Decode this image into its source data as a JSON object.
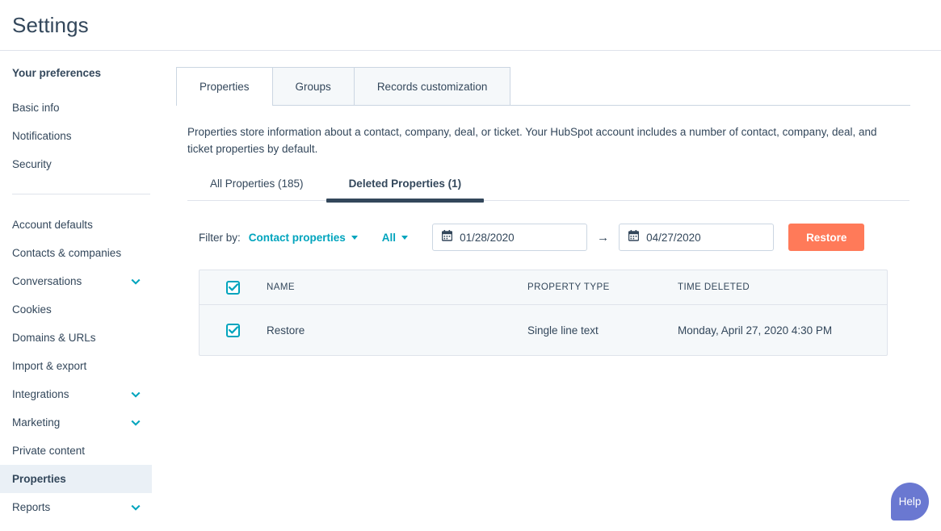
{
  "header": {
    "title": "Settings"
  },
  "sidebar": {
    "heading": "Your preferences",
    "group_one": [
      {
        "label": "Basic info",
        "expandable": false
      },
      {
        "label": "Notifications",
        "expandable": false
      },
      {
        "label": "Security",
        "expandable": false
      }
    ],
    "group_two": [
      {
        "label": "Account defaults",
        "expandable": false
      },
      {
        "label": "Contacts & companies",
        "expandable": false
      },
      {
        "label": "Conversations",
        "expandable": true
      },
      {
        "label": "Cookies",
        "expandable": false
      },
      {
        "label": "Domains & URLs",
        "expandable": false
      },
      {
        "label": "Import & export",
        "expandable": false
      },
      {
        "label": "Integrations",
        "expandable": true
      },
      {
        "label": "Marketing",
        "expandable": true
      },
      {
        "label": "Private content",
        "expandable": false
      },
      {
        "label": "Properties",
        "expandable": false,
        "active": true
      },
      {
        "label": "Reports",
        "expandable": true
      }
    ]
  },
  "main": {
    "tabs": [
      {
        "label": "Properties",
        "active": true
      },
      {
        "label": "Groups",
        "active": false
      },
      {
        "label": "Records customization",
        "active": false
      }
    ],
    "description": "Properties store information about a contact, company, deal, or ticket. Your HubSpot account includes a number of contact, company, deal, and ticket properties by default.",
    "sub_tabs": [
      {
        "label": "All Properties (185)",
        "active": false
      },
      {
        "label": "Deleted Properties (1)",
        "active": true
      }
    ],
    "filter": {
      "label": "Filter by:",
      "object_dropdown": "Contact properties",
      "type_dropdown": "All",
      "date_from": "01/28/2020",
      "date_to": "04/27/2020",
      "date_separator": "→",
      "restore_label": "Restore"
    },
    "table": {
      "columns": [
        "NAME",
        "PROPERTY TYPE",
        "TIME DELETED"
      ],
      "rows": [
        {
          "name": "Restore",
          "property_type": "Single line text",
          "time_deleted": "Monday, April 27, 2020 4:30 PM",
          "checked": true
        }
      ],
      "header_checked": true
    }
  },
  "help": {
    "label": "Help"
  },
  "colors": {
    "brand_orange": "#ff7a59",
    "teal": "#00a4bd",
    "navy": "#33475b",
    "help_purple": "#6a78d1",
    "panel_bg": "#f5f8fa",
    "active_nav_bg": "#eaf0f6",
    "border": "#dfe3eb"
  }
}
